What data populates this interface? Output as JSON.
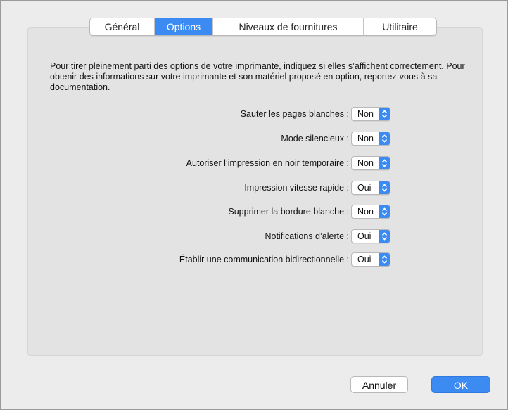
{
  "tabs": [
    {
      "label": "Général",
      "active": false
    },
    {
      "label": "Options",
      "active": true
    },
    {
      "label": "Niveaux de fournitures",
      "active": false
    },
    {
      "label": "Utilitaire",
      "active": false
    }
  ],
  "description": "Pour tirer pleinement parti des options de votre imprimante, indiquez si elles s’affichent correctement. Pour obtenir des informations sur votre imprimante et son matériel proposé en option, reportez-vous à sa documentation.",
  "options": [
    {
      "label": "Sauter les pages blanches :",
      "value": "Non"
    },
    {
      "label": "Mode silencieux :",
      "value": "Non"
    },
    {
      "label": "Autoriser l’impression en noir temporaire :",
      "value": "Non"
    },
    {
      "label": "Impression vitesse rapide :",
      "value": "Oui"
    },
    {
      "label": "Supprimer la bordure blanche :",
      "value": "Non"
    },
    {
      "label": "Notifications d’alerte :",
      "value": "Oui"
    },
    {
      "label": "Établir une communication bidirectionnelle :",
      "value": "Oui"
    }
  ],
  "buttons": {
    "cancel": "Annuler",
    "ok": "OK"
  },
  "colors": {
    "accent": "#3b8bf3",
    "panel": "#e3e3e3",
    "window": "#ececec"
  }
}
